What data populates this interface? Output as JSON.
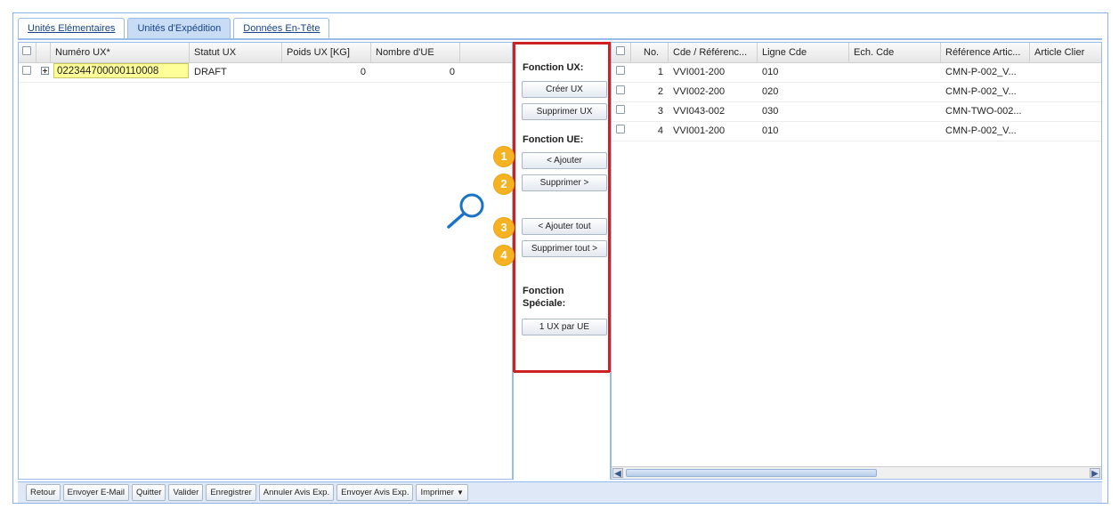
{
  "tabs": [
    {
      "label": "Unités Elémentaires"
    },
    {
      "label": "Unités d'Expédition"
    },
    {
      "label": "Données En-Tête"
    }
  ],
  "left_grid": {
    "headers": [
      "Numéro UX*",
      "Statut UX",
      "Poids UX [KG]",
      "Nombre d'UE"
    ],
    "rows": [
      {
        "numero": "022344700000110008",
        "statut": "DRAFT",
        "poids": "0",
        "nombre": "0"
      }
    ]
  },
  "functions": {
    "ux_title": "Fonction UX:",
    "creer_ux": "Créer UX",
    "supprimer_ux": "Supprimer UX",
    "ue_title": "Fonction UE:",
    "ajouter": "< Ajouter",
    "supprimer": "Supprimer >",
    "ajouter_tout": "< Ajouter tout",
    "supprimer_tout": "Supprimer tout >",
    "speciale_title_1": "Fonction",
    "speciale_title_2": "Spéciale:",
    "ux_par_ue": "1 UX par UE"
  },
  "badges": [
    "1",
    "2",
    "3",
    "4"
  ],
  "right_grid": {
    "headers": [
      "No.",
      "Cde / Référenc...",
      "Ligne Cde",
      "Ech. Cde",
      "Référence Artic...",
      "Article Clier"
    ],
    "rows": [
      {
        "no": "1",
        "cde": "VVI001-200",
        "ligne": "010",
        "ech": "",
        "ref": "CMN-P-002_V...",
        "art": ""
      },
      {
        "no": "2",
        "cde": "VVI002-200",
        "ligne": "020",
        "ech": "",
        "ref": "CMN-P-002_V...",
        "art": ""
      },
      {
        "no": "3",
        "cde": "VVI043-002",
        "ligne": "030",
        "ech": "",
        "ref": "CMN-TWO-002...",
        "art": ""
      },
      {
        "no": "4",
        "cde": "VVI001-200",
        "ligne": "010",
        "ech": "",
        "ref": "CMN-P-002_V...",
        "art": ""
      }
    ]
  },
  "toolbar": {
    "buttons": [
      "Retour",
      "Envoyer E-Mail",
      "Quitter",
      "Valider",
      "Enregistrer",
      "Annuler Avis Exp.",
      "Envoyer Avis Exp."
    ],
    "imprimer": "Imprimer"
  },
  "icons": {
    "magnifier": "magnifier-icon",
    "caret": "chevron-down-icon",
    "scroll_left": "arrow-left-icon",
    "scroll_right": "arrow-right-icon"
  },
  "colors": {
    "highlight_border": "#cc2222",
    "badge": "#f5b324",
    "ux_field": "#ffff99",
    "grid_border": "#99bbe8"
  }
}
